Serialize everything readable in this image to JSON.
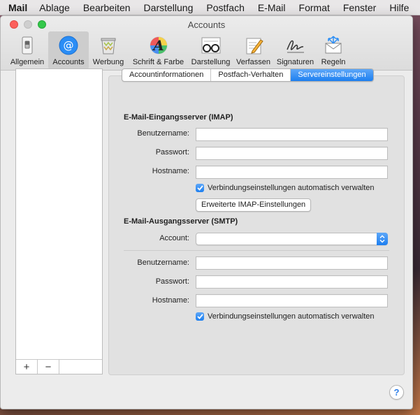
{
  "menubar": {
    "app": "Mail",
    "items": [
      "Ablage",
      "Bearbeiten",
      "Darstellung",
      "Postfach",
      "E-Mail",
      "Format",
      "Fenster",
      "Hilfe"
    ]
  },
  "window": {
    "title": "Accounts"
  },
  "toolbar": {
    "items": [
      {
        "label": "Allgemein",
        "icon": "switch-icon"
      },
      {
        "label": "Accounts",
        "icon": "at-sign-icon",
        "active": true
      },
      {
        "label": "Werbung",
        "icon": "trash-icon"
      },
      {
        "label": "Schrift & Farbe",
        "icon": "font-icon"
      },
      {
        "label": "Darstellung",
        "icon": "glasses-icon"
      },
      {
        "label": "Verfassen",
        "icon": "pencil-icon"
      },
      {
        "label": "Signaturen",
        "icon": "signature-icon"
      },
      {
        "label": "Regeln",
        "icon": "rules-icon"
      }
    ]
  },
  "sidebar": {
    "add": "+",
    "remove": "−"
  },
  "tabs": [
    {
      "label": "Accountinformationen"
    },
    {
      "label": "Postfach-Verhalten"
    },
    {
      "label": "Servereinstellungen",
      "selected": true
    }
  ],
  "incoming": {
    "heading": "E-Mail-Eingangsserver (IMAP)",
    "username_label": "Benutzername:",
    "username_value": "",
    "password_label": "Passwort:",
    "password_value": "",
    "hostname_label": "Hostname:",
    "hostname_value": "",
    "auto_manage": "Verbindungseinstellungen automatisch verwalten",
    "auto_manage_checked": true,
    "advanced_button": "Erweiterte IMAP-Einstellungen"
  },
  "outgoing": {
    "heading": "E-Mail-Ausgangsserver (SMTP)",
    "account_label": "Account:",
    "account_value": "",
    "username_label": "Benutzername:",
    "username_value": "",
    "password_label": "Passwort:",
    "password_value": "",
    "hostname_label": "Hostname:",
    "hostname_value": "",
    "auto_manage": "Verbindungseinstellungen automatisch verwalten",
    "auto_manage_checked": true
  },
  "help": "?",
  "colors": {
    "accent": "#1d7ff0",
    "close": "#fc605c",
    "zoom": "#34c84a"
  }
}
